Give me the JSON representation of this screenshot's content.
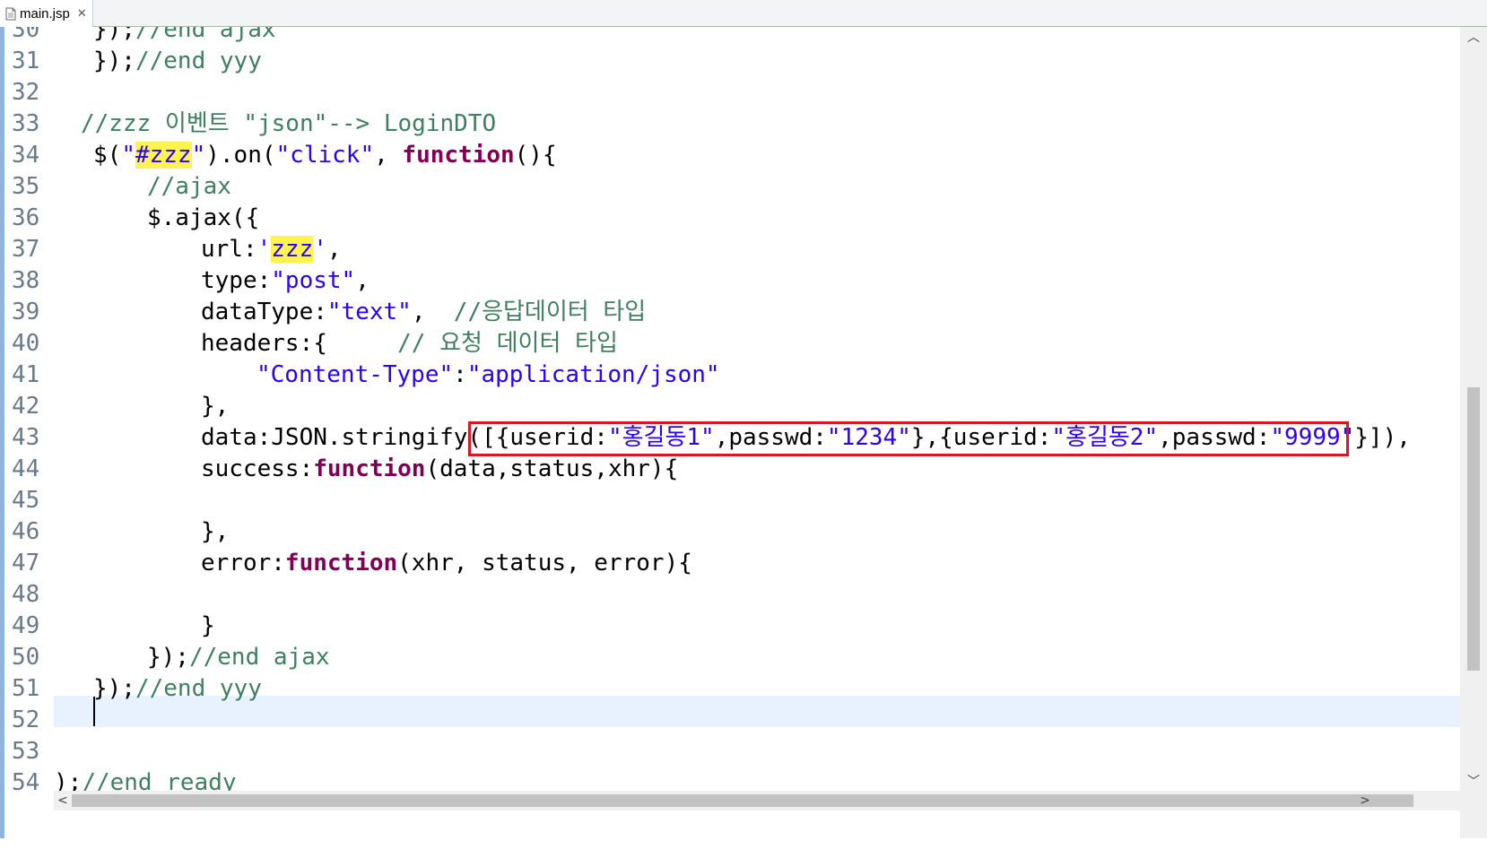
{
  "tab": {
    "title": "main.jsp",
    "close": "✕"
  },
  "editor": {
    "lines": [
      {
        "num": "30",
        "text": "});//end ajax"
      },
      {
        "num": "31",
        "text": "});//end yyy"
      },
      {
        "num": "32",
        "text": ""
      },
      {
        "num": "33",
        "text": "//zzz 이벤트 \"json\"--> LoginDTO"
      },
      {
        "num": "34",
        "text": "$(\"#zzz\").on(\"click\", function(){"
      },
      {
        "num": "35",
        "text": "//ajax"
      },
      {
        "num": "36",
        "text": "$.ajax({"
      },
      {
        "num": "37",
        "text": "url:'zzz',"
      },
      {
        "num": "38",
        "text": "type:\"post\","
      },
      {
        "num": "39",
        "text": "dataType:\"text\",  //응답데이터 타입"
      },
      {
        "num": "40",
        "text": "headers:{     // 요청 데이터 타입"
      },
      {
        "num": "41",
        "text": "\"Content-Type\":\"application/json\""
      },
      {
        "num": "42",
        "text": "},"
      },
      {
        "num": "43",
        "text": "data:JSON.stringify([{userid:\"홍길동1\",passwd:\"1234\"},{userid:\"홍길동2\",passwd:\"9999\"}]),"
      },
      {
        "num": "44",
        "text": "success:function(data,status,xhr){"
      },
      {
        "num": "45",
        "text": ""
      },
      {
        "num": "46",
        "text": "},"
      },
      {
        "num": "47",
        "text": "error:function(xhr, status, error){"
      },
      {
        "num": "48",
        "text": ""
      },
      {
        "num": "49",
        "text": "}"
      },
      {
        "num": "50",
        "text": "});//end ajax"
      },
      {
        "num": "51",
        "text": "});//end yyy"
      },
      {
        "num": "52",
        "text": ""
      },
      {
        "num": "53",
        "text": ""
      },
      {
        "num": "54",
        "text": ");//end ready"
      }
    ],
    "current_line": "52",
    "highlighted_line": "43"
  },
  "scrollbars": {
    "up": "︿",
    "down": "﹀",
    "left": "<",
    "right": ">"
  },
  "colors": {
    "comment": "#3f7f5f",
    "string": "#2a00ff",
    "keyword": "#7f0055",
    "highlight": "#fff44f",
    "red_box": "#e0141e",
    "current_line": "#e8f2fe"
  }
}
